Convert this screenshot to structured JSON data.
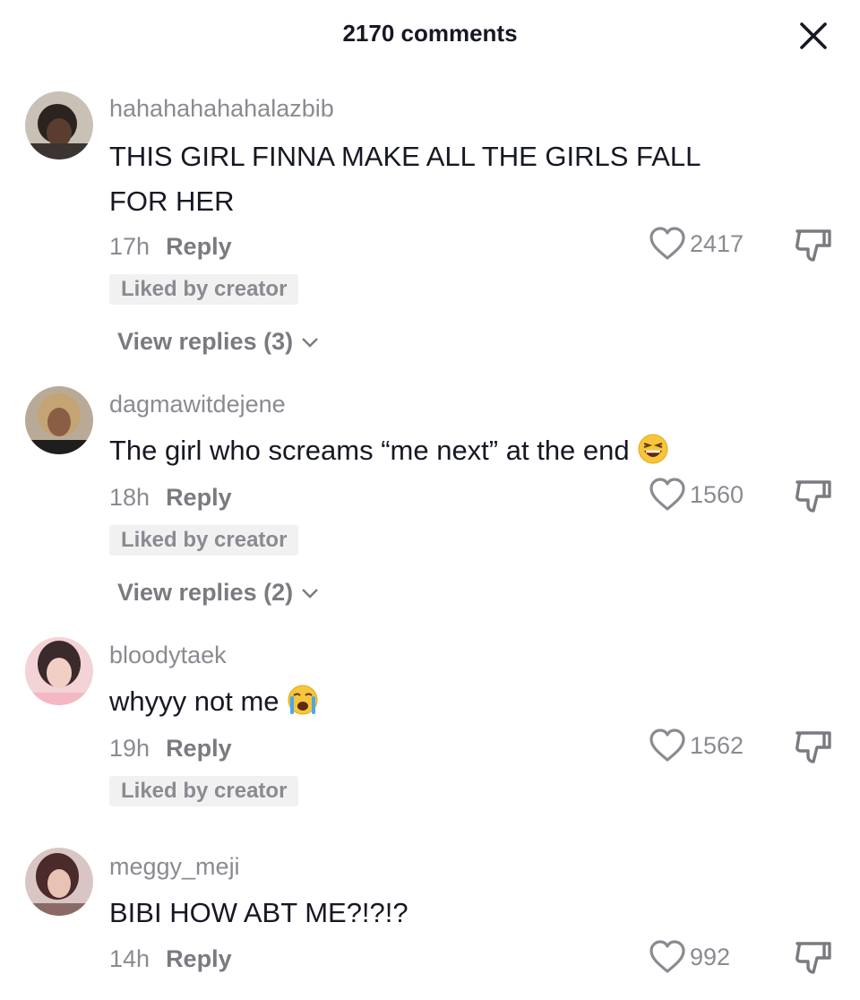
{
  "header": {
    "title": "2170 comments",
    "close_icon": "close-icon"
  },
  "comments": [
    {
      "username": "hahahahahahalazbib",
      "text": "THIS GIRL FINNA MAKE ALL THE GIRLS FALL FOR HER",
      "time": "17h",
      "reply_label": "Reply",
      "likes": "2417",
      "badge": "Liked by creator",
      "view_replies": "View replies (3)"
    },
    {
      "username": "dagmawitdejene",
      "text": "The girl who screams “me next” at the end",
      "emoji": "grinning-squinting-face-emoji",
      "time": "18h",
      "reply_label": "Reply",
      "likes": "1560",
      "badge": "Liked by creator",
      "view_replies": "View replies (2)"
    },
    {
      "username": "bloodytaek",
      "text": "whyyy not me",
      "emoji": "crying-face-emoji",
      "time": "19h",
      "reply_label": "Reply",
      "likes": "1562",
      "badge": "Liked by creator"
    },
    {
      "username": "meggy_meji",
      "text": "BIBI HOW ABT ME?!?!?",
      "time": "14h",
      "reply_label": "Reply",
      "likes": "992"
    }
  ],
  "colors": {
    "text": "#161823",
    "muted": "#8a8b91",
    "badge_bg": "#f1f1f2"
  }
}
